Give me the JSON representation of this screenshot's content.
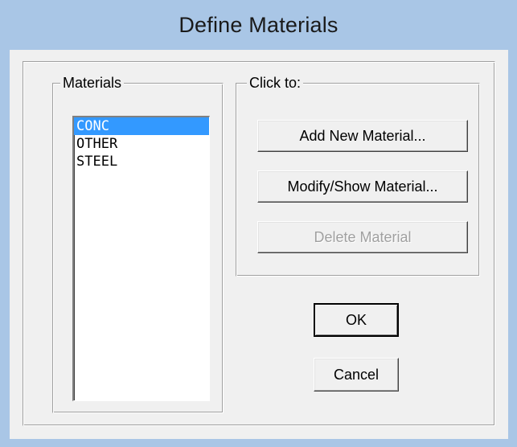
{
  "window": {
    "title": "Define Materials"
  },
  "materials": {
    "group_label": "Materials",
    "items": [
      "CONC",
      "OTHER",
      "STEEL"
    ],
    "selected": "CONC"
  },
  "actions": {
    "group_label": "Click to:",
    "add_label": "Add New Material...",
    "modify_label": "Modify/Show Material...",
    "delete_label": "Delete Material",
    "delete_enabled": false
  },
  "dialog": {
    "ok_label": "OK",
    "cancel_label": "Cancel"
  },
  "colors": {
    "title_bar": "#a9c6e6",
    "selection": "#3399ff",
    "face": "#f0f0f0"
  }
}
